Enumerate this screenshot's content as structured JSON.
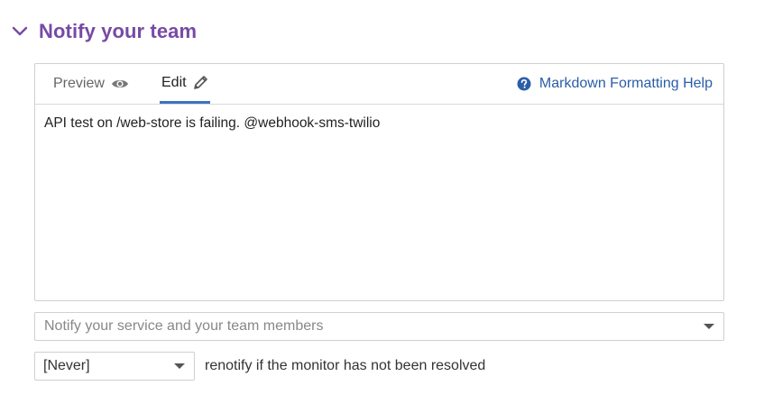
{
  "section": {
    "title": "Notify your team",
    "chevron_icon": "chevron-down-icon",
    "title_color": "#774aa4"
  },
  "editor": {
    "tabs": [
      {
        "label": "Preview",
        "icon": "eye-icon",
        "active": false
      },
      {
        "label": "Edit",
        "icon": "pencil-icon",
        "active": true
      }
    ],
    "help_link": {
      "label": "Markdown Formatting Help",
      "icon": "question-circle-icon"
    },
    "message": "API test on /web-store is failing. @webhook-sms-twilio",
    "accent_color": "#3b73c1"
  },
  "notify_select": {
    "placeholder": "Notify your service and your team members"
  },
  "renotify": {
    "selected": "[Never]",
    "label": "renotify if the monitor has not been resolved"
  }
}
